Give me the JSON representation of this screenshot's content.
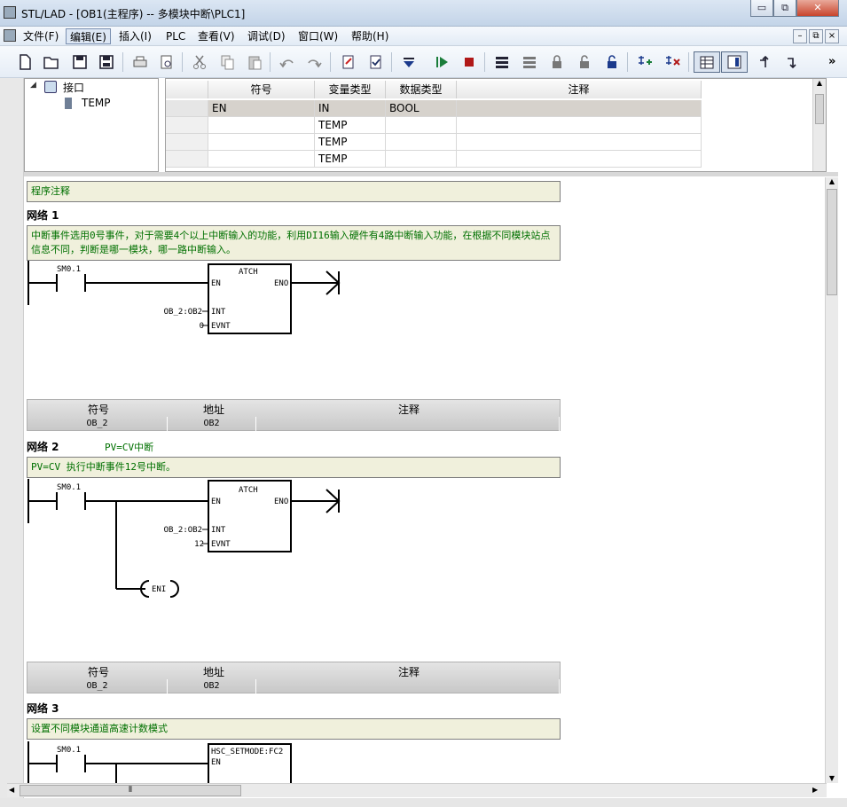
{
  "window": {
    "title": "STL/LAD - [OB1(主程序) -- 多模块中断\\PLC1]",
    "btn_min": "▭",
    "btn_max": "⧉",
    "btn_close": "✕"
  },
  "menu": [
    "文件(F)",
    "编辑(E)",
    "插入(I)",
    "PLC",
    "查看(V)",
    "调试(D)",
    "窗口(W)",
    "帮助(H)"
  ],
  "mdi_controls": [
    "–",
    "⧉",
    "×"
  ],
  "toolbar": {
    "icons": [
      "new-icon",
      "open-icon",
      "save-icon",
      "save-all-icon",
      "print-icon",
      "print-preview-icon",
      "cut-icon",
      "copy-icon",
      "paste-icon",
      "undo-icon",
      "redo-icon",
      "compile-icon",
      "compile-all-icon",
      "download-icon",
      "run-icon",
      "stop-icon",
      "upload-icon",
      "compare-icon",
      "lock-icon",
      "unlock-icon",
      "unlock-all-icon",
      "insert-network-icon",
      "delete-network-icon",
      "ladder-view-icon",
      "status-view-icon",
      "step-up-icon",
      "step-down-icon"
    ],
    "overflow": "»"
  },
  "tree": {
    "root": "接口",
    "child": "TEMP",
    "expander": "◢"
  },
  "var_table": {
    "headers": [
      "符号",
      "变量类型",
      "数据类型",
      "注释"
    ],
    "rows": [
      {
        "symbol": "EN",
        "var_type": "IN",
        "data_type": "BOOL",
        "comment": ""
      },
      {
        "symbol": "",
        "var_type": "TEMP",
        "data_type": "",
        "comment": ""
      },
      {
        "symbol": "",
        "var_type": "TEMP",
        "data_type": "",
        "comment": ""
      },
      {
        "symbol": "",
        "var_type": "TEMP",
        "data_type": "",
        "comment": ""
      }
    ]
  },
  "program_comment": "程序注释",
  "networks": [
    {
      "label": "网络 1",
      "title": "",
      "comment": "中断事件选用0号事件，对于需要4个以上中断输入的功能，利用DI16输入硬件有4路中断输入功能，在根据不同模块站点信息不同，判断是哪一模块，哪一路中断输入。",
      "contact": "SM0.1",
      "box": {
        "name": "ATCH",
        "en": "EN",
        "eno": "ENO",
        "int_label": "INT",
        "evnt_label": "EVNT",
        "int_value": "OB_2:OB2",
        "evnt_value": "0"
      },
      "sym_table": {
        "headers": [
          "符号",
          "地址",
          "注释"
        ],
        "row": [
          "OB_2",
          "OB2",
          ""
        ]
      }
    },
    {
      "label": "网络 2",
      "title": "PV=CV中断",
      "comment": "PV=CV 执行中断事件12号中断。",
      "contact": "SM0.1",
      "box": {
        "name": "ATCH",
        "en": "EN",
        "eno": "ENO",
        "int_label": "INT",
        "evnt_label": "EVNT",
        "int_value": "OB_2:OB2",
        "evnt_value": "12"
      },
      "coil": "ENI",
      "sym_table": {
        "headers": [
          "符号",
          "地址",
          "注释"
        ],
        "row": [
          "OB_2",
          "OB2",
          ""
        ]
      }
    },
    {
      "label": "网络 3",
      "title": "",
      "comment": "设置不同模块通道高速计数模式",
      "contact": "SM0.1",
      "box": {
        "name": "HSC_SETMODE:FC2",
        "en": "EN"
      }
    }
  ],
  "scroll": {
    "up": "▲",
    "down": "▼",
    "left": "◀",
    "right": "▶",
    "grip": "⦀"
  }
}
